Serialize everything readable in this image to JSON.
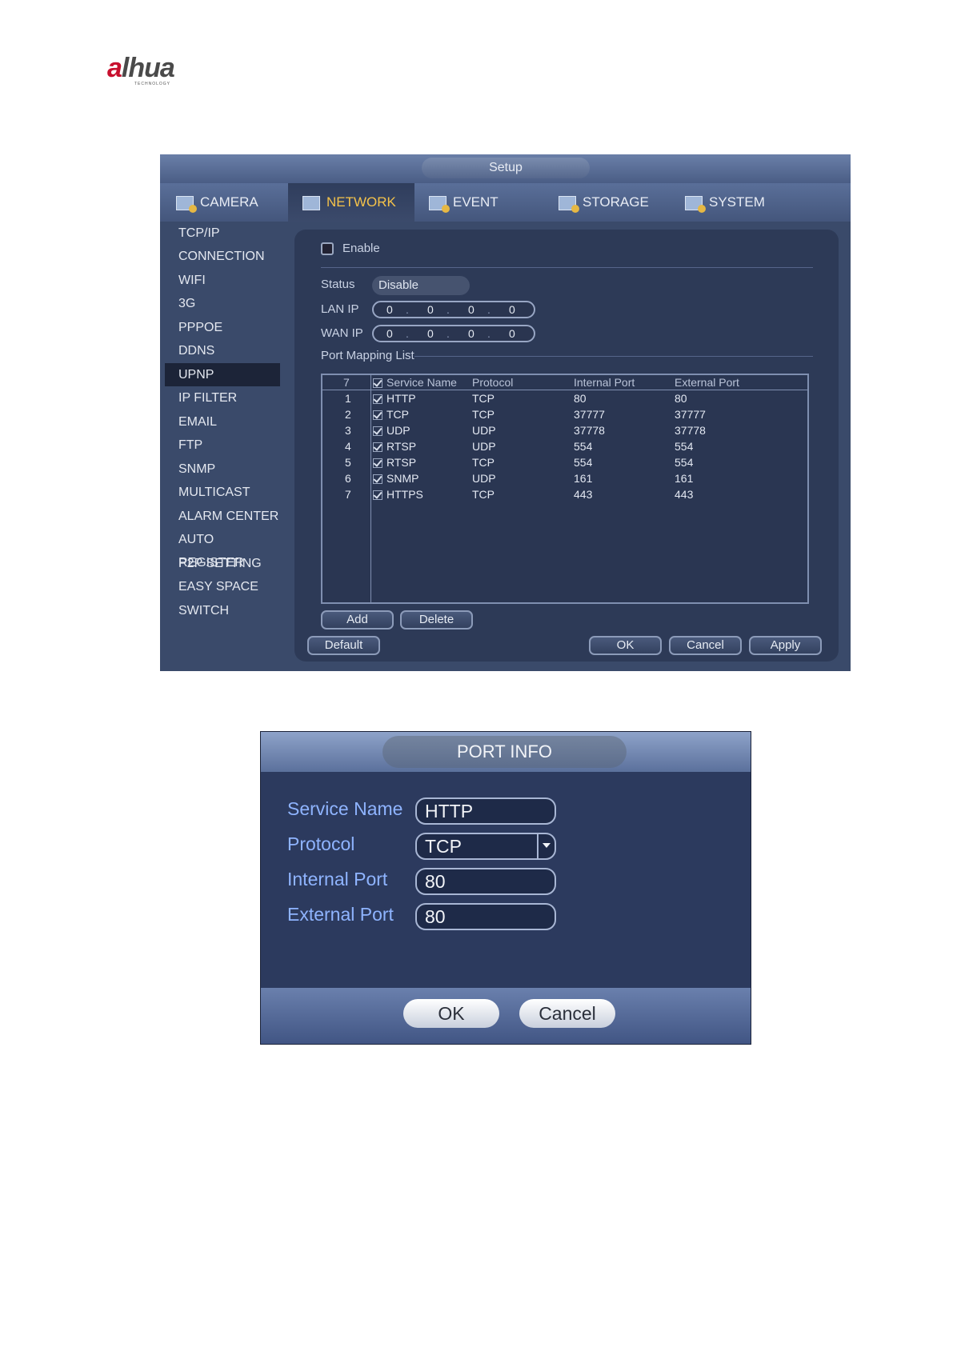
{
  "logo": {
    "brand_a": "a",
    "brand_rest": "lhua",
    "tagline": "TECHNOLOGY"
  },
  "setup": {
    "title": "Setup",
    "tabs": [
      {
        "label": "CAMERA",
        "icon": "camera-icon"
      },
      {
        "label": "NETWORK",
        "icon": "network-icon"
      },
      {
        "label": "EVENT",
        "icon": "event-icon"
      },
      {
        "label": "STORAGE",
        "icon": "storage-icon"
      },
      {
        "label": "SYSTEM",
        "icon": "system-icon"
      }
    ],
    "active_tab": "NETWORK",
    "sidebar": [
      "TCP/IP",
      "CONNECTION",
      "WIFI",
      "3G",
      "PPPOE",
      "DDNS",
      "UPNP",
      "IP FILTER",
      "EMAIL",
      "FTP",
      "SNMP",
      "MULTICAST",
      "ALARM CENTER",
      "AUTO REGISTER",
      "P2P SETTING",
      "EASY SPACE",
      "SWITCH"
    ],
    "active_sidebar": "UPNP",
    "enable_label": "Enable",
    "status_label": "Status",
    "status_value": "Disable",
    "lan_ip_label": "LAN IP",
    "lan_ip": [
      "0",
      "0",
      "0",
      "0"
    ],
    "wan_ip_label": "WAN IP",
    "wan_ip": [
      "0",
      "0",
      "0",
      "0"
    ],
    "port_mapping_label": "Port Mapping List",
    "table": {
      "count": "7",
      "headers": [
        "Service Name",
        "Protocol",
        "Internal Port",
        "External Port"
      ],
      "rows": [
        {
          "n": "1",
          "service": "HTTP",
          "protocol": "TCP",
          "internal": "80",
          "external": "80"
        },
        {
          "n": "2",
          "service": "TCP",
          "protocol": "TCP",
          "internal": "37777",
          "external": "37777"
        },
        {
          "n": "3",
          "service": "UDP",
          "protocol": "UDP",
          "internal": "37778",
          "external": "37778"
        },
        {
          "n": "4",
          "service": "RTSP",
          "protocol": "UDP",
          "internal": "554",
          "external": "554"
        },
        {
          "n": "5",
          "service": "RTSP",
          "protocol": "TCP",
          "internal": "554",
          "external": "554"
        },
        {
          "n": "6",
          "service": "SNMP",
          "protocol": "UDP",
          "internal": "161",
          "external": "161"
        },
        {
          "n": "7",
          "service": "HTTPS",
          "protocol": "TCP",
          "internal": "443",
          "external": "443"
        }
      ]
    },
    "buttons": {
      "add": "Add",
      "delete": "Delete",
      "default": "Default",
      "ok": "OK",
      "cancel": "Cancel",
      "apply": "Apply"
    }
  },
  "port_info": {
    "title": "PORT INFO",
    "service_name_label": "Service Name",
    "service_name": "HTTP",
    "protocol_label": "Protocol",
    "protocol": "TCP",
    "internal_port_label": "Internal Port",
    "internal_port": "80",
    "external_port_label": "External Port",
    "external_port": "80",
    "ok": "OK",
    "cancel": "Cancel"
  }
}
